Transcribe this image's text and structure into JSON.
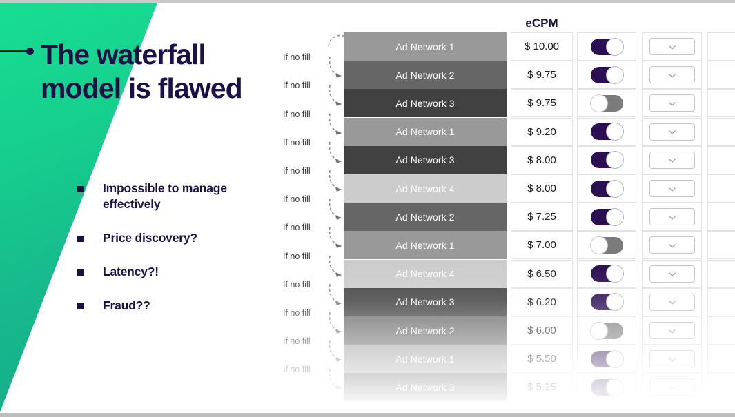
{
  "slide": {
    "title_line1": "The waterfall",
    "title_line2": "model is flawed",
    "title_color": "#1d1046",
    "accent_green_start": "#18dd93",
    "accent_green_end": "#14a98a",
    "bullets": [
      {
        "text": "Impossible to manage effectively"
      },
      {
        "text": "Price discovery?"
      },
      {
        "text": "Latency?!"
      },
      {
        "text": "Fraud??"
      }
    ]
  },
  "table": {
    "ecpm_header": "eCPM",
    "nofill_label": "If no fill",
    "toggle_on_color": "#2b0f52",
    "toggle_off_color": "#7b7b7b",
    "network_colors": {
      "Ad Network 1": "#999999",
      "Ad Network 2": "#666666",
      "Ad Network 3": "#414141",
      "Ad Network 4": "#cccccc"
    },
    "rows": [
      {
        "network": "Ad Network 1",
        "ecpm": "$ 10.00",
        "toggle": "on",
        "has_nofill": false
      },
      {
        "network": "Ad Network 2",
        "ecpm": "$ 9.75",
        "toggle": "on",
        "has_nofill": true
      },
      {
        "network": "Ad Network 3",
        "ecpm": "$ 9.75",
        "toggle": "off",
        "has_nofill": true
      },
      {
        "network": "Ad Network 1",
        "ecpm": "$ 9.20",
        "toggle": "on",
        "has_nofill": true
      },
      {
        "network": "Ad Network 3",
        "ecpm": "$ 8.00",
        "toggle": "on",
        "has_nofill": true
      },
      {
        "network": "Ad Network 4",
        "ecpm": "$ 8.00",
        "toggle": "on",
        "has_nofill": true
      },
      {
        "network": "Ad Network 2",
        "ecpm": "$ 7.25",
        "toggle": "on",
        "has_nofill": true
      },
      {
        "network": "Ad Network 1",
        "ecpm": "$ 7.00",
        "toggle": "off",
        "has_nofill": true
      },
      {
        "network": "Ad Network 4",
        "ecpm": "$ 6.50",
        "toggle": "on",
        "has_nofill": true
      },
      {
        "network": "Ad Network 3",
        "ecpm": "$ 6.20",
        "toggle": "on",
        "has_nofill": true
      },
      {
        "network": "Ad Network 2",
        "ecpm": "$ 6.00",
        "toggle": "off",
        "has_nofill": true
      },
      {
        "network": "Ad Network 1",
        "ecpm": "$ 5.50",
        "toggle": "on",
        "has_nofill": true
      },
      {
        "network": "Ad Network 3",
        "ecpm": "$ 5.25",
        "toggle": "on",
        "has_nofill": true
      }
    ]
  }
}
